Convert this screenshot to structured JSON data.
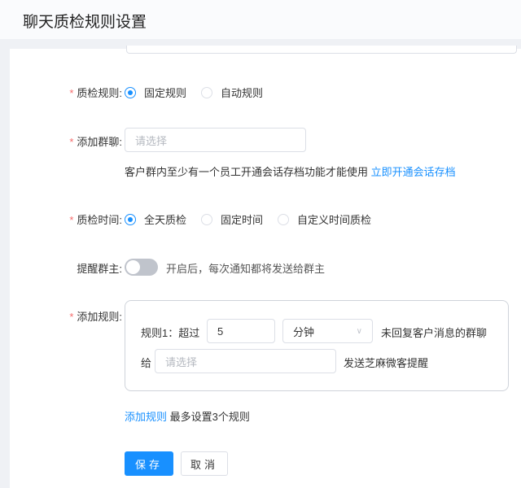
{
  "header": {
    "title": "聊天质检规则设置"
  },
  "form": {
    "rule_type": {
      "label": "质检规则:",
      "options": [
        "固定规则",
        "自动规则"
      ],
      "selected": 0
    },
    "group_chat": {
      "label": "添加群聊:",
      "placeholder": "请选择",
      "hint": "客户群内至少有一个员工开通会话存档功能才能使用",
      "hint_link": "立即开通会话存档"
    },
    "check_time": {
      "label": "质检时间:",
      "options": [
        "全天质检",
        "固定时间",
        "自定义时间质检"
      ],
      "selected": 0
    },
    "notify_owner": {
      "label": "提醒群主:",
      "enabled": false,
      "hint": "开启后，每次通知都将发送给群主"
    },
    "rules": {
      "label": "添加规则:",
      "items": [
        {
          "prefix": "规则1：超过",
          "value": "5",
          "unit": "分钟",
          "suffix": "未回复客户消息的群聊",
          "to": "给",
          "recipient_placeholder": "请选择",
          "send_text": "发送芝麻微客提醒"
        }
      ],
      "add_link": "添加规则",
      "limit_hint": "最多设置3个规则"
    }
  },
  "buttons": {
    "save": "保存",
    "cancel": "取消"
  },
  "colors": {
    "primary": "#1890ff",
    "required": "#f56c6c"
  }
}
